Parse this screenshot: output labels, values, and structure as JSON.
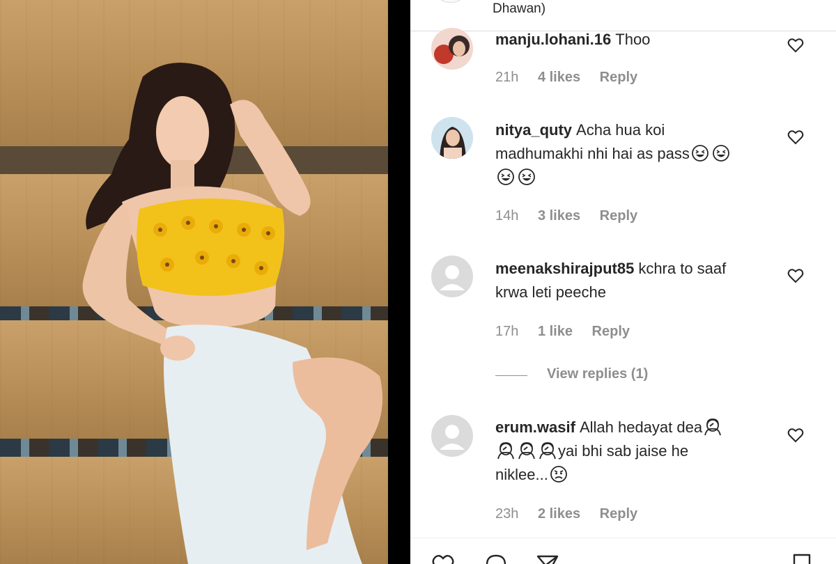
{
  "top_fragment": "Dhawan)",
  "comments": [
    {
      "username": "manju.lohani.16",
      "text": "Thoo",
      "time": "21h",
      "likes": "4 likes",
      "reply": "Reply"
    },
    {
      "username": "nitya_quty",
      "text_line1": "Acha hua koi",
      "text_line2": "madhumakhi nhi hai as pass",
      "time": "14h",
      "likes": "3 likes",
      "reply": "Reply"
    },
    {
      "username": "meenakshirajput85",
      "text_line1": "kchra to saaf",
      "text_line2": "krwa leti peeche",
      "time": "17h",
      "likes": "1 like",
      "reply": "Reply",
      "view_replies": "View replies (1)"
    },
    {
      "username": "erum.wasif",
      "text_line1": "Allah hedayat dea",
      "text_line2": "yai bhi sab jaise he",
      "text_line3": "niklee...",
      "time": "23h",
      "likes": "2 likes",
      "reply": "Reply"
    }
  ],
  "icons": {
    "heart": "heart-outline-icon",
    "like": "like-icon",
    "comment": "comment-icon",
    "share": "share-icon",
    "save": "bookmark-icon"
  },
  "colors": {
    "text": "#262626",
    "secondary": "#8e8e8e",
    "separator": "#dbdbdb",
    "divider": "#000000"
  }
}
